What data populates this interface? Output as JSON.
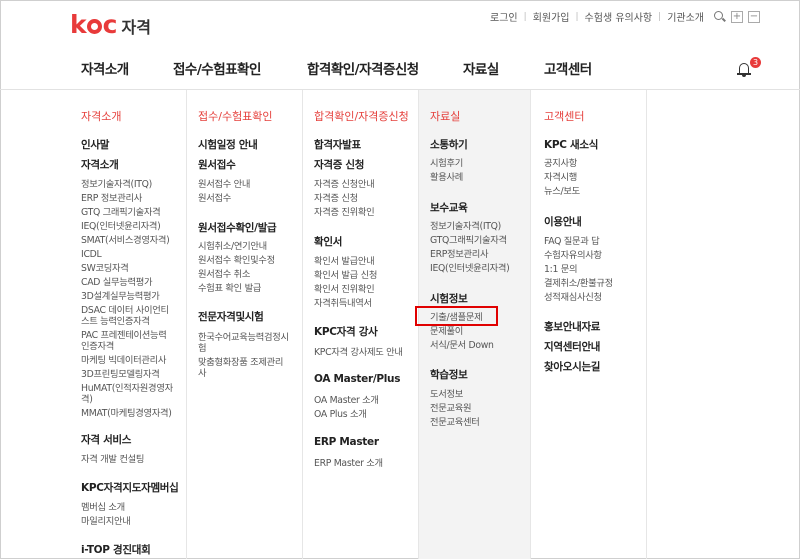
{
  "brand": {
    "logo_text": "kpc",
    "title": "자격"
  },
  "util_links": [
    "로그인",
    "회원가입",
    "수험생 유의사항",
    "기관소개"
  ],
  "zoom_in": "+",
  "zoom_out": "−",
  "nav": [
    "자격소개",
    "접수/수험표확인",
    "합격확인/자격증신청",
    "자료실",
    "고객센터"
  ],
  "notification_count": "3",
  "menu": {
    "col1": {
      "head": "자격소개",
      "secs": [
        "인사말",
        "자격소개",
        "자격 서비스",
        "KPC자격지도자멤버십",
        "i-TOP 경진대회"
      ],
      "subs": [
        "정보기술자격(ITQ)",
        "ERP 정보관리사",
        "GTQ 그래픽기술자격",
        "IEQ(인터넷윤리자격)",
        "SMAT(서비스경영자격)",
        "ICDL",
        "SW코딩자격",
        "CAD 실무능력평가",
        "3D설계실무능력평가",
        "DSAC 데이터 사이언티",
        "스트 능력인증자격",
        "PAC 프레젠테이션능력",
        "인증자격",
        "마케팅 빅데이터관리사",
        "3D프린팅모델링자격",
        "HuMAT(인적자원경영자",
        "격)",
        "MMAT(마케팅경영자격)"
      ],
      "service_subs": [
        "자격 개발 컨설팅"
      ],
      "member_subs": [
        "멤버십 소개",
        "마일리지안내"
      ]
    },
    "col2": {
      "head": "접수/수험표확인",
      "secs": [
        "시험일정 안내",
        "원서접수",
        "원서접수확인/발급",
        "전문자격및시험"
      ],
      "apply_subs": [
        "원서접수 안내",
        "원서접수"
      ],
      "confirm_subs": [
        "시험취소/연기안내",
        "원서접수 확인및수정",
        "원서접수 취소",
        "수험표 확인 발급"
      ],
      "pro_subs": [
        "한국수어교육능력검정시",
        "험",
        "맞춤형화장품 조제관리",
        "사"
      ]
    },
    "col3": {
      "head": "합격확인/자격증신청",
      "secs": [
        "합격자발표",
        "자격증 신청",
        "확인서",
        "KPC자격 강사",
        "OA Master/Plus",
        "ERP Master"
      ],
      "cert_subs": [
        "자격증 신청안내",
        "자격증 신청",
        "자격증 진위확인"
      ],
      "confirm_subs": [
        "확인서 발급안내",
        "확인서 발급 신청",
        "확인서 진위확인",
        "자격취득내역서"
      ],
      "lecturer_subs": [
        "KPC자격 강사제도 안내"
      ],
      "oa_subs": [
        "OA Master 소개",
        "OA Plus 소개"
      ],
      "erp_subs": [
        "ERP Master 소개"
      ]
    },
    "col4": {
      "head": "자료실",
      "secs": [
        "소통하기",
        "보수교육",
        "시험정보",
        "학습정보"
      ],
      "comm_subs": [
        "시험후기",
        "활용사례"
      ],
      "edu_subs": [
        "정보기술자격(ITQ)",
        "GTQ그래픽기술자격",
        "ERP정보관리사",
        "IEQ(인터넷윤리자격)"
      ],
      "exam_subs": [
        "기출/샘플문제",
        "문제풀이",
        "서식/문서 Down"
      ],
      "study_subs": [
        "도서정보",
        "전문교육원",
        "전문교육센터"
      ]
    },
    "col5": {
      "head": "고객센터",
      "secs": [
        "KPC 새소식",
        "이용안내",
        "홍보안내자료",
        "지역센터안내",
        "찾아오시는길"
      ],
      "news_subs": [
        "공지사항",
        "자격시행",
        "뉴스/보도"
      ],
      "guide_subs": [
        "FAQ 질문과 답",
        "수험자유의사항",
        "1:1 문의",
        "결제취소/환불규정",
        "성적재심사신청"
      ]
    }
  }
}
